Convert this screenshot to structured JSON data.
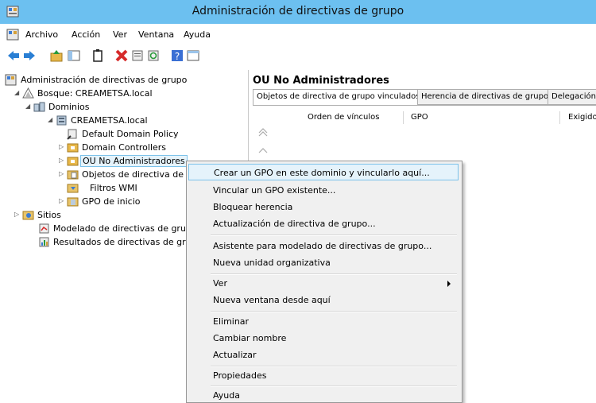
{
  "window": {
    "title": "Administración de directivas de grupo"
  },
  "menu": [
    "Archivo",
    "Acción",
    "Ver",
    "Ventana",
    "Ayuda"
  ],
  "tree": {
    "root": "Administración de directivas de grupo",
    "forest": "Bosque: CREAMETSA.local",
    "domains": "Dominios",
    "domain": "CREAMETSA.local",
    "children": [
      "Default Domain Policy",
      "Domain Controllers",
      "OU No Administradores",
      "Objetos de directiva de",
      "Filtros WMI",
      "GPO de inicio"
    ],
    "sites": "Sitios",
    "modeling": "Modelado de directivas de grup",
    "results": "Resultados de directivas de gru"
  },
  "right": {
    "title": "OU No Administradores",
    "tabs": [
      "Objetos de directiva de grupo vinculados",
      "Herencia de directivas de grupo",
      "Delegación"
    ],
    "columns": [
      "Orden de vínculos",
      "GPO",
      "Exigido"
    ]
  },
  "context_menu": {
    "items": [
      "Crear un GPO en este dominio y vincularlo aquí...",
      "Vincular un GPO existente...",
      "Bloquear herencia",
      "Actualización de directiva de grupo...",
      "Asistente para modelado de directivas de grupo...",
      "Nueva unidad organizativa",
      "Ver",
      "Nueva ventana desde aquí",
      "Eliminar",
      "Cambiar nombre",
      "Actualizar",
      "Propiedades",
      "Ayuda"
    ]
  },
  "icons": {
    "app": "gpmc-console-icon",
    "back": "back-arrow-icon",
    "forward": "forward-arrow-icon",
    "up": "up-folder-icon",
    "show-tree": "show-hide-tree-icon",
    "clipboard": "copy-icon",
    "delete": "delete-icon",
    "properties": "properties-icon",
    "refresh": "refresh-icon",
    "help": "help-icon",
    "console": "console-icon"
  }
}
